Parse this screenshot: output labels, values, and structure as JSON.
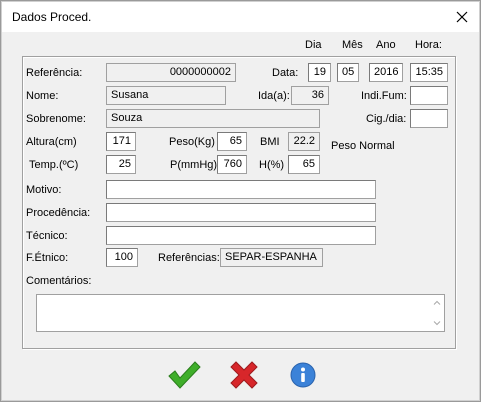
{
  "window": {
    "title": "Dados Proced.",
    "close_icon": "close-icon"
  },
  "date_headers": {
    "day": "Dia",
    "month": "Mês",
    "year": "Ano",
    "hour": "Hora:"
  },
  "referencia": {
    "label": "Referência:",
    "value": "0000000002"
  },
  "data": {
    "label": "Data:",
    "day": "19",
    "month": "05",
    "year": "2016",
    "time": "15:35"
  },
  "nome": {
    "label": "Nome:",
    "value": "Susana"
  },
  "idade": {
    "label": "Ida(a):",
    "value": "36"
  },
  "indi_fum": {
    "label": "Indi.Fum:",
    "value": ""
  },
  "sobrenome": {
    "label": "Sobrenome:",
    "value": "Souza"
  },
  "cig_dia": {
    "label": "Cig./dia:",
    "value": ""
  },
  "altura": {
    "label": "Altura(cm)",
    "value": "171"
  },
  "peso": {
    "label": "Peso(Kg)",
    "value": "65"
  },
  "bmi": {
    "label": "BMI",
    "value": "22.2",
    "status": "Peso Normal"
  },
  "temp": {
    "label": "Temp.(ºC)",
    "value": "25"
  },
  "pressao": {
    "label": "P(mmHg)",
    "value": "760"
  },
  "umidade": {
    "label": "H(%)",
    "value": "65"
  },
  "motivo": {
    "label": "Motivo:",
    "value": ""
  },
  "procedencia": {
    "label": "Procedência:",
    "value": ""
  },
  "tecnico": {
    "label": "Técnico:",
    "value": ""
  },
  "etnico": {
    "label": "F.Étnico:",
    "value": "100"
  },
  "referencias": {
    "label": "Referências:",
    "value": "SEPAR-ESPANHA"
  },
  "comentarios": {
    "label": "Comentários:",
    "value": ""
  },
  "buttons": {
    "ok": "checkmark-icon",
    "cancel": "x-icon",
    "info": "info-icon"
  },
  "colors": {
    "ok": "#3fae2a",
    "cancel": "#d7262a",
    "info": "#3b82d8"
  }
}
